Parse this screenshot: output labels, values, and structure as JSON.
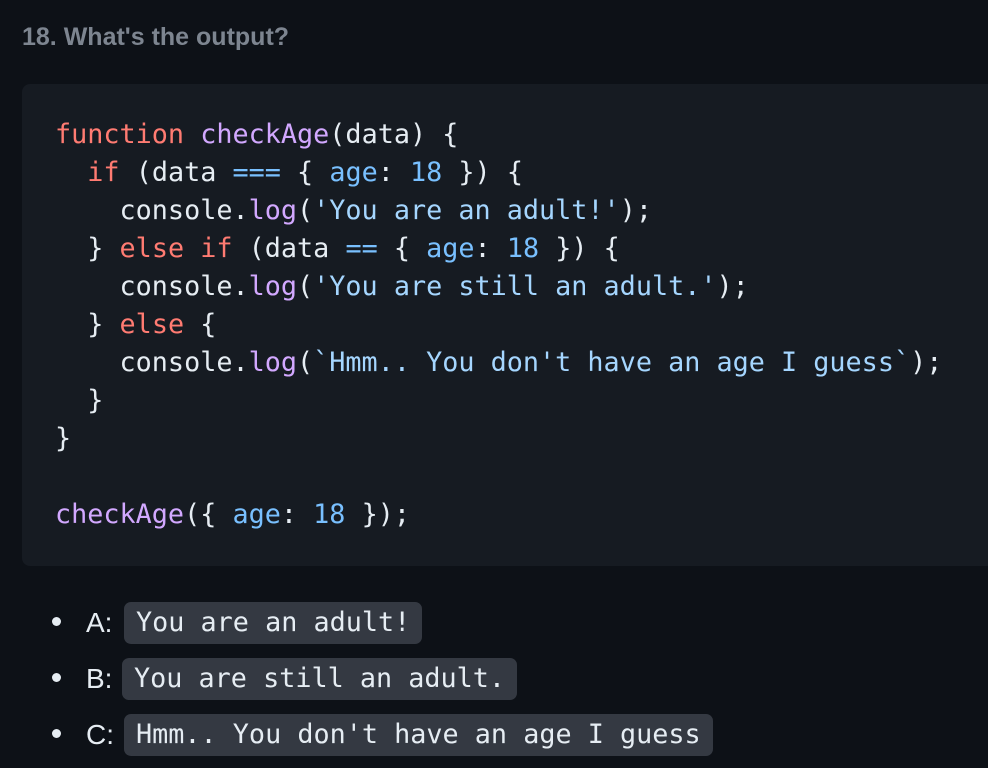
{
  "question": {
    "title": "18. What's the output?"
  },
  "code": {
    "lines": [
      [
        {
          "t": "function",
          "c": "kw"
        },
        {
          "t": " "
        },
        {
          "t": "checkAge",
          "c": "fn"
        },
        {
          "t": "(data) {"
        }
      ],
      [
        {
          "t": "  "
        },
        {
          "t": "if",
          "c": "kw"
        },
        {
          "t": " (data "
        },
        {
          "t": "===",
          "c": "op"
        },
        {
          "t": " { "
        },
        {
          "t": "age",
          "c": "prop"
        },
        {
          "t": ": "
        },
        {
          "t": "18",
          "c": "num"
        },
        {
          "t": " }) {"
        }
      ],
      [
        {
          "t": "    console."
        },
        {
          "t": "log",
          "c": "fn"
        },
        {
          "t": "("
        },
        {
          "t": "'You are an adult!'",
          "c": "str"
        },
        {
          "t": ");"
        }
      ],
      [
        {
          "t": "  } "
        },
        {
          "t": "else",
          "c": "kw"
        },
        {
          "t": " "
        },
        {
          "t": "if",
          "c": "kw"
        },
        {
          "t": " (data "
        },
        {
          "t": "==",
          "c": "op"
        },
        {
          "t": " { "
        },
        {
          "t": "age",
          "c": "prop"
        },
        {
          "t": ": "
        },
        {
          "t": "18",
          "c": "num"
        },
        {
          "t": " }) {"
        }
      ],
      [
        {
          "t": "    console."
        },
        {
          "t": "log",
          "c": "fn"
        },
        {
          "t": "("
        },
        {
          "t": "'You are still an adult.'",
          "c": "str"
        },
        {
          "t": ");"
        }
      ],
      [
        {
          "t": "  } "
        },
        {
          "t": "else",
          "c": "kw"
        },
        {
          "t": " {"
        }
      ],
      [
        {
          "t": "    console."
        },
        {
          "t": "log",
          "c": "fn"
        },
        {
          "t": "("
        },
        {
          "t": "`Hmm.. You don't have an age I guess`",
          "c": "str"
        },
        {
          "t": ");"
        }
      ],
      [
        {
          "t": "  }"
        }
      ],
      [
        {
          "t": "}"
        }
      ],
      [
        {
          "t": ""
        }
      ],
      [
        {
          "t": "checkAge",
          "c": "fn"
        },
        {
          "t": "({ "
        },
        {
          "t": "age",
          "c": "prop"
        },
        {
          "t": ": "
        },
        {
          "t": "18",
          "c": "num"
        },
        {
          "t": " });"
        }
      ]
    ]
  },
  "answers": [
    {
      "letter": "A:",
      "code": "You are an adult!"
    },
    {
      "letter": "B:",
      "code": "You are still an adult."
    },
    {
      "letter": "C:",
      "code": "Hmm.. You don't have an age I guess"
    }
  ],
  "colors": {
    "background": "#0d1117",
    "code_background": "#161b22",
    "keyword": "#ff7b72",
    "function": "#d2a8ff",
    "property": "#79c0ff",
    "string": "#a5d6ff",
    "heading": "#7d8590",
    "inline_code_background": "#343942"
  }
}
